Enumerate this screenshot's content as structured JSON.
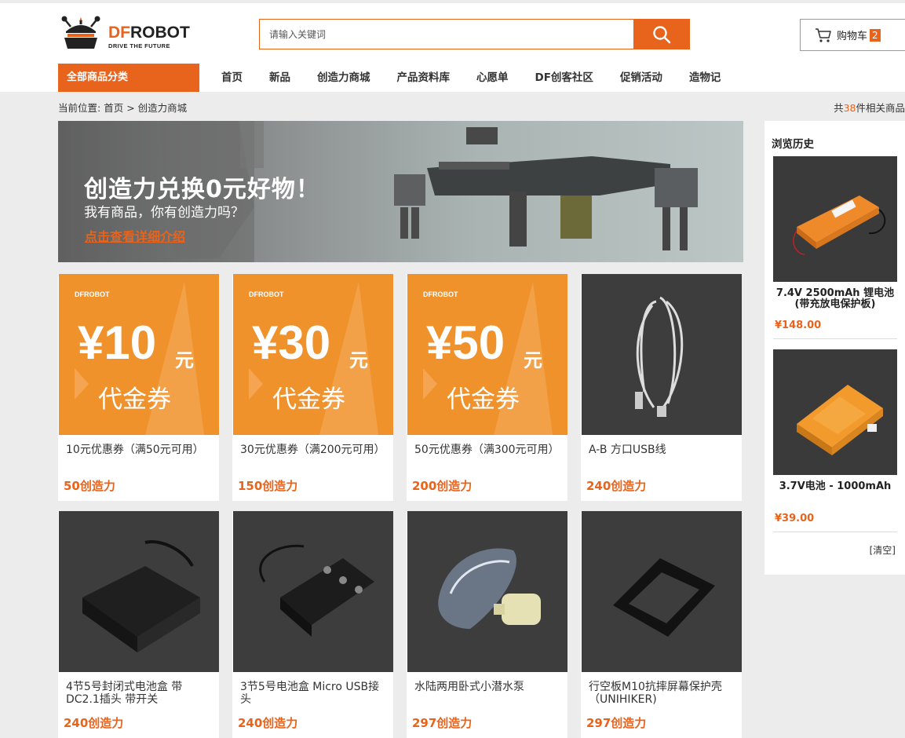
{
  "header": {
    "logo_df": "DF",
    "logo_robot": "ROBOT",
    "logo_tagline": "DRIVE THE FUTURE",
    "search_placeholder": "请输入关键词",
    "cart_label": "购物车",
    "cart_count": "2"
  },
  "nav": {
    "category_label": "全部商品分类",
    "items": [
      "首页",
      "新品",
      "创造力商城",
      "产品资料库",
      "心愿单",
      "DF创客社区",
      "促销活动",
      "造物记"
    ]
  },
  "breadcrumb": {
    "prefix": "当前位置:",
    "home": "首页",
    "separator": ">",
    "current": "创造力商城"
  },
  "results": {
    "pre": "共",
    "count": "38",
    "post": "件相关商品"
  },
  "banner": {
    "title": "创造力兑换0元好物！",
    "subtitle": "我有商品，你有创造力吗？",
    "link": "点击查看详细介绍"
  },
  "coupon_art": {
    "brand": "DFROBOT",
    "word": "代金券",
    "unit": "元"
  },
  "products": [
    {
      "name": "10元优惠券（满50元可用）",
      "price": "50创造力",
      "art": "coupon",
      "amount": "¥10"
    },
    {
      "name": "30元优惠券（满200元可用）",
      "price": "150创造力",
      "art": "coupon",
      "amount": "¥30"
    },
    {
      "name": "50元优惠券（满300元可用）",
      "price": "200创造力",
      "art": "coupon",
      "amount": "¥50"
    },
    {
      "name": "A-B 方口USB线",
      "price": "240创造力",
      "art": "usb-cable-icon"
    },
    {
      "name": "4节5号封闭式电池盒 带DC2.1插头 带开关",
      "price": "240创造力",
      "art": "battery-box-icon"
    },
    {
      "name": "3节5号电池盒 Micro USB接头",
      "price": "240创造力",
      "art": "battery-holder-icon"
    },
    {
      "name": "水陆两用卧式小潜水泵",
      "price": "297创造力",
      "art": "water-pump-icon"
    },
    {
      "name": "行空板M10抗摔屏幕保护壳（UNIHIKER)",
      "price": "297创造力",
      "art": "case-icon"
    }
  ],
  "sidebar": {
    "title": "浏览历史",
    "items": [
      {
        "name": "7.4V 2500mAh 锂电池(带充放电保护板)",
        "price": "¥148.00",
        "art": "lipo-battery-icon"
      },
      {
        "name": "3.7V电池 - 1000mAh",
        "price": "¥39.00",
        "art": "battery-icon"
      }
    ],
    "clear_label": "[清空]"
  },
  "colors": {
    "accent": "#e8631c",
    "coupon_bg": "#f0922b"
  }
}
